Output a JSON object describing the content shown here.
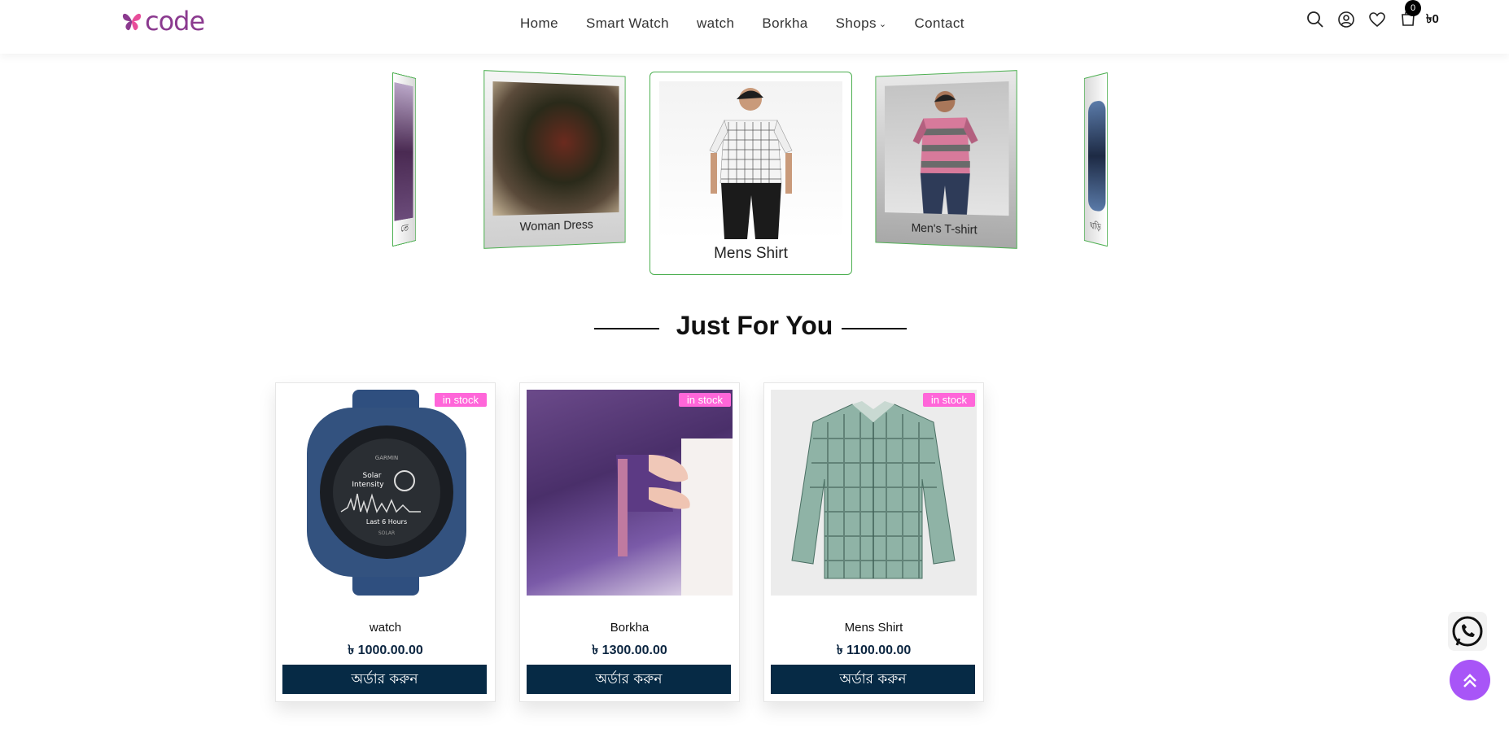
{
  "brand": {
    "name": "code",
    "icon": "butterfly-logo-icon"
  },
  "nav": {
    "items": [
      {
        "label": "Home"
      },
      {
        "label": "Smart Watch"
      },
      {
        "label": "watch"
      },
      {
        "label": "Borkha"
      },
      {
        "label": "Shops",
        "has_dropdown": true
      },
      {
        "label": "Contact"
      }
    ]
  },
  "header_icons": {
    "search": "search-icon",
    "account": "user-circle-icon",
    "wishlist": "heart-icon",
    "cart": "shopping-bag-icon",
    "cart_count": "0",
    "cart_total": "৳0"
  },
  "carousel": {
    "slides": [
      {
        "caption": "তে"
      },
      {
        "caption": "Woman Dress"
      },
      {
        "caption": "Mens Shirt"
      },
      {
        "caption": "Men's T-shirt"
      },
      {
        "caption": "ঘড়ি"
      }
    ]
  },
  "section": {
    "title": "Just For You"
  },
  "products": [
    {
      "name": "watch",
      "price": "৳ 1000.00.00",
      "badge": "in stock",
      "button": "অর্ডার করুন"
    },
    {
      "name": "Borkha",
      "price": "৳ 1300.00.00",
      "badge": "in stock",
      "button": "অর্ডার করুন"
    },
    {
      "name": "Mens Shirt",
      "price": "৳ 1100.00.00",
      "badge": "in stock",
      "button": "অর্ডার করুন"
    }
  ],
  "floating": {
    "whatsapp": "whatsapp-icon",
    "scroll_top": "double-chevron-up-icon"
  },
  "colors": {
    "accent": "#a855f7",
    "badge": "#ff66d9",
    "button": "#062a45",
    "carousel_border": "#4caf50",
    "logo": "#8b3a8f"
  }
}
